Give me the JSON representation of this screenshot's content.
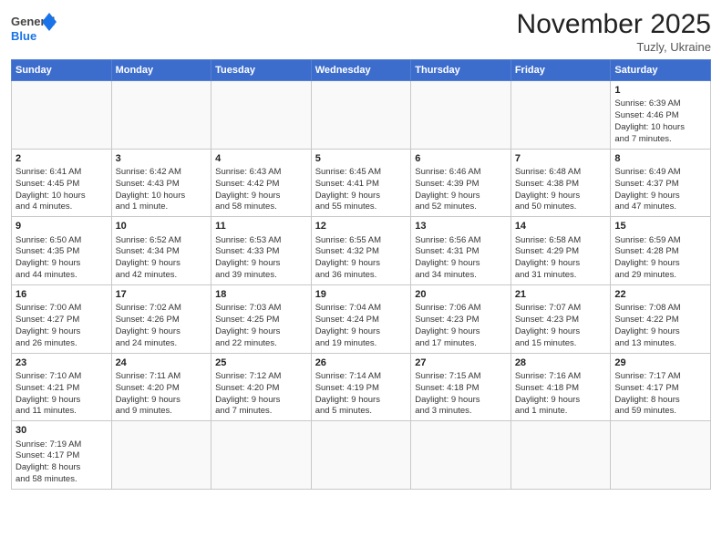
{
  "header": {
    "logo_general": "General",
    "logo_blue": "Blue",
    "month_title": "November 2025",
    "location": "Tuzly, Ukraine"
  },
  "weekdays": [
    "Sunday",
    "Monday",
    "Tuesday",
    "Wednesday",
    "Thursday",
    "Friday",
    "Saturday"
  ],
  "weeks": [
    [
      {
        "day": "",
        "info": ""
      },
      {
        "day": "",
        "info": ""
      },
      {
        "day": "",
        "info": ""
      },
      {
        "day": "",
        "info": ""
      },
      {
        "day": "",
        "info": ""
      },
      {
        "day": "",
        "info": ""
      },
      {
        "day": "1",
        "info": "Sunrise: 6:39 AM\nSunset: 4:46 PM\nDaylight: 10 hours\nand 7 minutes."
      }
    ],
    [
      {
        "day": "2",
        "info": "Sunrise: 6:41 AM\nSunset: 4:45 PM\nDaylight: 10 hours\nand 4 minutes."
      },
      {
        "day": "3",
        "info": "Sunrise: 6:42 AM\nSunset: 4:43 PM\nDaylight: 10 hours\nand 1 minute."
      },
      {
        "day": "4",
        "info": "Sunrise: 6:43 AM\nSunset: 4:42 PM\nDaylight: 9 hours\nand 58 minutes."
      },
      {
        "day": "5",
        "info": "Sunrise: 6:45 AM\nSunset: 4:41 PM\nDaylight: 9 hours\nand 55 minutes."
      },
      {
        "day": "6",
        "info": "Sunrise: 6:46 AM\nSunset: 4:39 PM\nDaylight: 9 hours\nand 52 minutes."
      },
      {
        "day": "7",
        "info": "Sunrise: 6:48 AM\nSunset: 4:38 PM\nDaylight: 9 hours\nand 50 minutes."
      },
      {
        "day": "8",
        "info": "Sunrise: 6:49 AM\nSunset: 4:37 PM\nDaylight: 9 hours\nand 47 minutes."
      }
    ],
    [
      {
        "day": "9",
        "info": "Sunrise: 6:50 AM\nSunset: 4:35 PM\nDaylight: 9 hours\nand 44 minutes."
      },
      {
        "day": "10",
        "info": "Sunrise: 6:52 AM\nSunset: 4:34 PM\nDaylight: 9 hours\nand 42 minutes."
      },
      {
        "day": "11",
        "info": "Sunrise: 6:53 AM\nSunset: 4:33 PM\nDaylight: 9 hours\nand 39 minutes."
      },
      {
        "day": "12",
        "info": "Sunrise: 6:55 AM\nSunset: 4:32 PM\nDaylight: 9 hours\nand 36 minutes."
      },
      {
        "day": "13",
        "info": "Sunrise: 6:56 AM\nSunset: 4:31 PM\nDaylight: 9 hours\nand 34 minutes."
      },
      {
        "day": "14",
        "info": "Sunrise: 6:58 AM\nSunset: 4:29 PM\nDaylight: 9 hours\nand 31 minutes."
      },
      {
        "day": "15",
        "info": "Sunrise: 6:59 AM\nSunset: 4:28 PM\nDaylight: 9 hours\nand 29 minutes."
      }
    ],
    [
      {
        "day": "16",
        "info": "Sunrise: 7:00 AM\nSunset: 4:27 PM\nDaylight: 9 hours\nand 26 minutes."
      },
      {
        "day": "17",
        "info": "Sunrise: 7:02 AM\nSunset: 4:26 PM\nDaylight: 9 hours\nand 24 minutes."
      },
      {
        "day": "18",
        "info": "Sunrise: 7:03 AM\nSunset: 4:25 PM\nDaylight: 9 hours\nand 22 minutes."
      },
      {
        "day": "19",
        "info": "Sunrise: 7:04 AM\nSunset: 4:24 PM\nDaylight: 9 hours\nand 19 minutes."
      },
      {
        "day": "20",
        "info": "Sunrise: 7:06 AM\nSunset: 4:23 PM\nDaylight: 9 hours\nand 17 minutes."
      },
      {
        "day": "21",
        "info": "Sunrise: 7:07 AM\nSunset: 4:23 PM\nDaylight: 9 hours\nand 15 minutes."
      },
      {
        "day": "22",
        "info": "Sunrise: 7:08 AM\nSunset: 4:22 PM\nDaylight: 9 hours\nand 13 minutes."
      }
    ],
    [
      {
        "day": "23",
        "info": "Sunrise: 7:10 AM\nSunset: 4:21 PM\nDaylight: 9 hours\nand 11 minutes."
      },
      {
        "day": "24",
        "info": "Sunrise: 7:11 AM\nSunset: 4:20 PM\nDaylight: 9 hours\nand 9 minutes."
      },
      {
        "day": "25",
        "info": "Sunrise: 7:12 AM\nSunset: 4:20 PM\nDaylight: 9 hours\nand 7 minutes."
      },
      {
        "day": "26",
        "info": "Sunrise: 7:14 AM\nSunset: 4:19 PM\nDaylight: 9 hours\nand 5 minutes."
      },
      {
        "day": "27",
        "info": "Sunrise: 7:15 AM\nSunset: 4:18 PM\nDaylight: 9 hours\nand 3 minutes."
      },
      {
        "day": "28",
        "info": "Sunrise: 7:16 AM\nSunset: 4:18 PM\nDaylight: 9 hours\nand 1 minute."
      },
      {
        "day": "29",
        "info": "Sunrise: 7:17 AM\nSunset: 4:17 PM\nDaylight: 8 hours\nand 59 minutes."
      }
    ],
    [
      {
        "day": "30",
        "info": "Sunrise: 7:19 AM\nSunset: 4:17 PM\nDaylight: 8 hours\nand 58 minutes."
      },
      {
        "day": "",
        "info": ""
      },
      {
        "day": "",
        "info": ""
      },
      {
        "day": "",
        "info": ""
      },
      {
        "day": "",
        "info": ""
      },
      {
        "day": "",
        "info": ""
      },
      {
        "day": "",
        "info": ""
      }
    ]
  ]
}
